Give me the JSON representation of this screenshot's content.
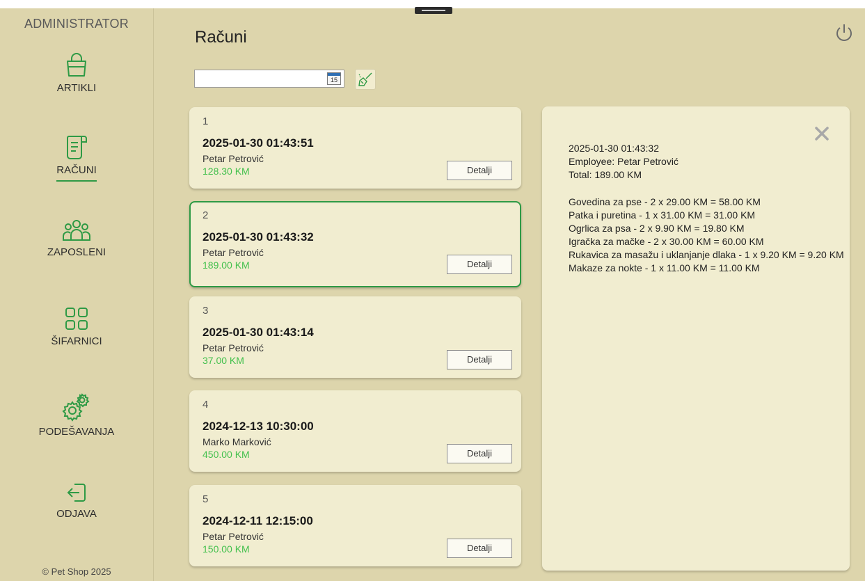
{
  "sidebar": {
    "role": "ADMINISTRATOR",
    "items": [
      {
        "label": "ARTIKLI",
        "icon": "shopping-bag-icon"
      },
      {
        "label": "RAČUNI",
        "icon": "receipt-icon",
        "active": true
      },
      {
        "label": "ZAPOSLENI",
        "icon": "team-icon"
      },
      {
        "label": "ŠIFARNICI",
        "icon": "grid-icon"
      },
      {
        "label": "PODEŠAVANJA",
        "icon": "gears-icon"
      },
      {
        "label": "ODJAVA",
        "icon": "logout-icon"
      }
    ],
    "copyright": "© Pet Shop 2025"
  },
  "header": {
    "title": "Računi"
  },
  "filter": {
    "date_value": "",
    "calendar_day": "15"
  },
  "colors": {
    "accent": "#2e9a45",
    "amount": "#43c04d",
    "background": "#ddd5ac",
    "card": "#f1edd0"
  },
  "receipts": [
    {
      "number": "1",
      "datetime": "2025-01-30 01:43:51",
      "employee": "Petar Petrović",
      "total": "128.30 KM",
      "details_label": "Detalji"
    },
    {
      "number": "2",
      "datetime": "2025-01-30 01:43:32",
      "employee": "Petar Petrović",
      "total": "189.00 KM",
      "details_label": "Detalji",
      "selected": true
    },
    {
      "number": "3",
      "datetime": "2025-01-30 01:43:14",
      "employee": "Petar Petrović",
      "total": "37.00 KM",
      "details_label": "Detalji"
    },
    {
      "number": "4",
      "datetime": "2024-12-13 10:30:00",
      "employee": "Marko Marković",
      "total": "450.00 KM",
      "details_label": "Detalji"
    },
    {
      "number": "5",
      "datetime": "2024-12-11 12:15:00",
      "employee": "Petar Petrović",
      "total": "150.00 KM",
      "details_label": "Detalji"
    }
  ],
  "detail": {
    "datetime": "2025-01-30 01:43:32",
    "employee_line": "Employee: Petar Petrović",
    "total_line": "Total: 189.00 KM",
    "items": [
      "Govedina za pse - 2 x 29.00 KM = 58.00 KM",
      "Patka i puretina - 1 x 31.00 KM = 31.00 KM",
      "Ogrlica za psa - 2 x 9.90 KM = 19.80 KM",
      "Igračka za mačke - 2 x 30.00 KM = 60.00 KM",
      "Rukavica za masažu i uklanjanje dlaka - 1 x 9.20 KM = 9.20 KM",
      "Makaze za nokte - 1 x 11.00 KM = 11.00 KM"
    ]
  }
}
